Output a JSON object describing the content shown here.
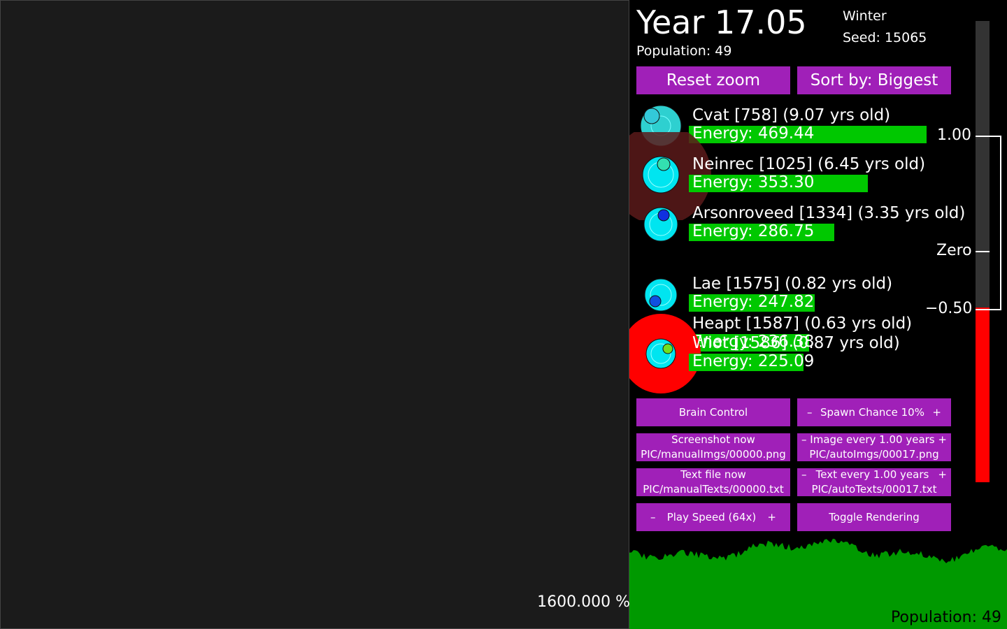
{
  "viewport": {
    "zoom_readout": "1600.000 %"
  },
  "header": {
    "year": "Year 17.05",
    "population": "Population: 49",
    "season": "Winter",
    "seed": "Seed: 15065"
  },
  "buttons": {
    "reset_zoom": "Reset zoom",
    "sort": "Sort by: Biggest",
    "brain_control": "Brain Control",
    "spawn_minus": "–",
    "spawn_label": "Spawn Chance 10%",
    "spawn_plus": "+",
    "screenshot_title": "Screenshot now",
    "screenshot_path": "PIC/manualImgs/00000.png",
    "image_every_minus": "–",
    "image_every_label": "Image every 1.00 years",
    "image_every_plus": "+",
    "image_every_path": "PIC/autoImgs/00017.png",
    "textfile_title": "Text file now",
    "textfile_path": "PIC/manualTexts/00000.txt",
    "text_every_minus": "–",
    "text_every_label": "Text every 1.00 years",
    "text_every_plus": "+",
    "text_every_path": "PIC/autoTexts/00017.txt",
    "speed_minus": "–",
    "speed_label": "Play Speed (64x)",
    "speed_plus": "+",
    "toggle_rendering": "Toggle Rendering"
  },
  "creatures": [
    {
      "name": "Cvat [758] (9.07 yrs old)",
      "energy": "Energy: 469.44",
      "energy_value": 469.44,
      "body_color": "#00e5e5",
      "mouth_color": "#33c9d9"
    },
    {
      "name": "Neinrec [1025] (6.45 yrs old)",
      "energy": "Energy: 353.30",
      "energy_value": 353.3,
      "body_color": "#00e5f0",
      "mouth_color": "#33e0b0"
    },
    {
      "name": "Arsonroveed [1334] (3.35 yrs old)",
      "energy": "Energy: 286.75",
      "energy_value": 286.75,
      "body_color": "#00e5f0",
      "mouth_color": "#1030e0"
    },
    {
      "name": "Lae [1575] (0.82 yrs old)",
      "energy": "Energy: 247.82",
      "energy_value": 247.82,
      "body_color": "#00e5f0",
      "mouth_color": "#1050e0"
    },
    {
      "name": "Heapt [1587] (0.63 yrs old)",
      "energy": "Energy: 236.38",
      "energy_value": 236.38,
      "body_color": "#00e5f0",
      "mouth_color": "#20d040"
    },
    {
      "name": "Wiot [1586] (0.87 yrs old)",
      "energy": "Energy: 225.09",
      "energy_value": 225.09,
      "body_color": "#00e5f0",
      "mouth_color": "#70e020"
    }
  ],
  "gauge": {
    "label_top": "1.00",
    "label_zero": "Zero",
    "label_bottom": "−0.50",
    "value": -0.5,
    "fill_color": "#ff0000"
  },
  "footer": {
    "population": "Population: 49"
  },
  "colors": {
    "button": "#a020b8",
    "energy_bar": "#00c800",
    "graph": "#009900"
  }
}
